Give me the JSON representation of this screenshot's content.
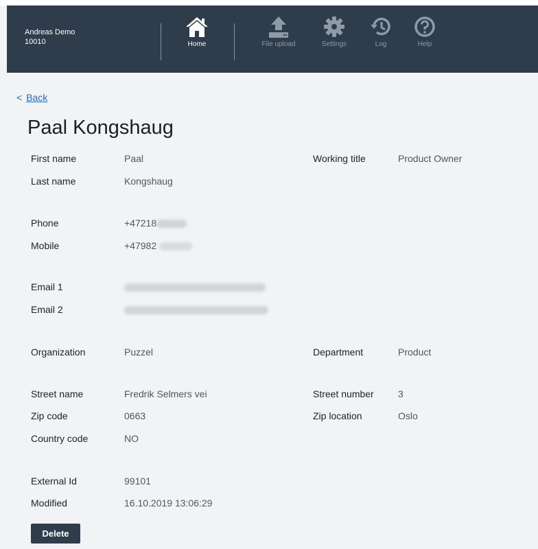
{
  "user": {
    "name": "Andreas Demo",
    "id": "10010"
  },
  "nav": [
    {
      "label": "Home",
      "icon": "home-icon",
      "active": true
    },
    {
      "label": "File upload",
      "icon": "upload-icon"
    },
    {
      "label": "Settings",
      "icon": "gear-icon"
    },
    {
      "label": "Log",
      "icon": "history-icon"
    },
    {
      "label": "Help",
      "icon": "help-icon"
    }
  ],
  "back_link": {
    "arrow": "<",
    "text": "Back"
  },
  "contact": {
    "name": "Paal Kongshaug",
    "labels": {
      "first_name": "First name",
      "last_name": "Last name",
      "phone": "Phone",
      "mobile": "Mobile",
      "email1": "Email 1",
      "email2": "Email 2",
      "organization": "Organization",
      "street_name": "Street name",
      "zip_code": "Zip code",
      "country_code": "Country code",
      "external_id": "External Id",
      "modified": "Modified",
      "working_title": "Working title",
      "department": "Department",
      "street_number": "Street number",
      "zip_location": "Zip location"
    },
    "values": {
      "first_name": "Paal",
      "last_name": "Kongshaug",
      "phone": "+47218",
      "mobile": "+47982",
      "organization": "Puzzel",
      "street_name": "Fredrik Selmers vei",
      "zip_code": "0663",
      "country_code": "NO",
      "external_id": "99101",
      "modified": "16.10.2019 13:06:29",
      "working_title": "Product Owner",
      "department": "Product",
      "street_number": "3",
      "zip_location": "Oslo"
    }
  },
  "actions": {
    "delete_label": "Delete"
  },
  "colors": {
    "header": "#2f3c4b",
    "background": "#f1f3f5",
    "link": "#2d68c4",
    "button": "#2f3c4b"
  }
}
